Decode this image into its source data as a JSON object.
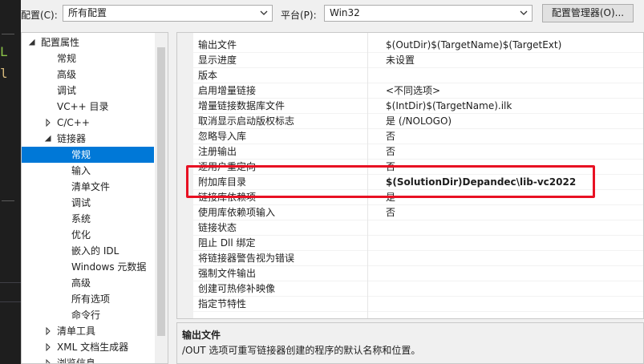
{
  "toolbar": {
    "config_label": "配置(C):",
    "config_value": "所有配置",
    "platform_label": "平台(P):",
    "platform_value": "Win32",
    "config_manager_button": "配置管理器(O)..."
  },
  "tree": {
    "items": [
      {
        "label": "配置属性",
        "expanded": true
      },
      {
        "label": "常规"
      },
      {
        "label": "高级"
      },
      {
        "label": "调试"
      },
      {
        "label": "VC++ 目录"
      },
      {
        "label": "C/C++",
        "expanded": false
      },
      {
        "label": "链接器",
        "expanded": true
      },
      {
        "label": "常规",
        "selected": true
      },
      {
        "label": "输入"
      },
      {
        "label": "清单文件"
      },
      {
        "label": "调试"
      },
      {
        "label": "系统"
      },
      {
        "label": "优化"
      },
      {
        "label": "嵌入的 IDL"
      },
      {
        "label": "Windows 元数据"
      },
      {
        "label": "高级"
      },
      {
        "label": "所有选项"
      },
      {
        "label": "命令行"
      },
      {
        "label": "清单工具",
        "expanded": false
      },
      {
        "label": "XML 文档生成器",
        "expanded": false
      },
      {
        "label": "浏览信息",
        "expanded": false
      }
    ]
  },
  "properties": [
    {
      "name": "输出文件",
      "value": "$(OutDir)$(TargetName)$(TargetExt)"
    },
    {
      "name": "显示进度",
      "value": "未设置"
    },
    {
      "name": "版本",
      "value": ""
    },
    {
      "name": "启用增量链接",
      "value": "<不同选项>"
    },
    {
      "name": "增量链接数据库文件",
      "value": "$(IntDir)$(TargetName).ilk"
    },
    {
      "name": "取消显示启动版权标志",
      "value": "是 (/NOLOGO)"
    },
    {
      "name": "忽略导入库",
      "value": "否"
    },
    {
      "name": "注册输出",
      "value": "否"
    },
    {
      "name": "逐用户重定向",
      "value": "否"
    },
    {
      "name": "附加库目录",
      "value": "$(SolutionDir)Depandec\\lib-vc2022",
      "bold": true
    },
    {
      "name": "链接库依赖项",
      "value": "是"
    },
    {
      "name": "使用库依赖项输入",
      "value": "否"
    },
    {
      "name": "链接状态",
      "value": ""
    },
    {
      "name": "阻止 Dll 绑定",
      "value": ""
    },
    {
      "name": "将链接器警告视为错误",
      "value": ""
    },
    {
      "name": "强制文件输出",
      "value": ""
    },
    {
      "name": "创建可热修补映像",
      "value": ""
    },
    {
      "name": "指定节特性",
      "value": ""
    }
  ],
  "description": {
    "title": "输出文件",
    "text": "/OUT 选项可重写链接器创建的程序的默认名称和位置。"
  },
  "colors": {
    "selection": "#0078d7",
    "highlight_box": "#e81123"
  }
}
